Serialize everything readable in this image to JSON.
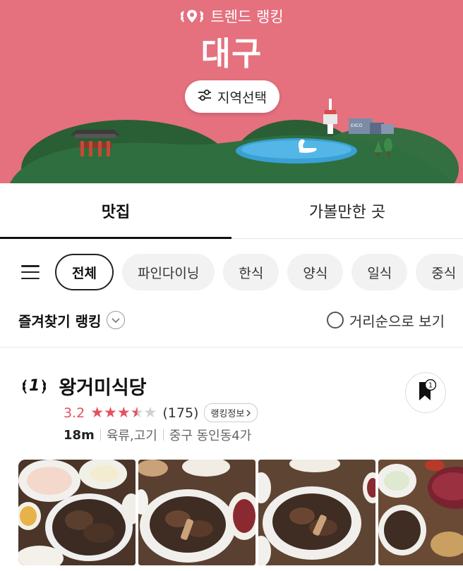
{
  "hero": {
    "subtitle": "트렌드 랭킹",
    "title": "대구",
    "region_button_label": "지역선택",
    "bg_color": "#e5707e",
    "building_sign": "EXCO"
  },
  "tabs": [
    {
      "label": "맛집",
      "active": true
    },
    {
      "label": "가볼만한 곳",
      "active": false
    }
  ],
  "categories": [
    {
      "label": "전체",
      "selected": true
    },
    {
      "label": "파인다이닝",
      "selected": false
    },
    {
      "label": "한식",
      "selected": false
    },
    {
      "label": "양식",
      "selected": false
    },
    {
      "label": "일식",
      "selected": false
    },
    {
      "label": "중식",
      "selected": false
    }
  ],
  "sort": {
    "ranking_label": "즐겨찾기 랭킹",
    "distance_toggle_label": "거리순으로 보기"
  },
  "restaurant": {
    "rank": "1",
    "name": "왕거미식당",
    "score": "3.2",
    "stars_filled": 3.2,
    "reviews": "(175)",
    "info_label": "랭킹정보",
    "distance": "18m",
    "category": "육류,고기",
    "location": "중구 동인동4가",
    "bookmark_count": "1"
  },
  "icons": {
    "subtitle": "laurel-pin-icon",
    "region": "sliders-icon",
    "menu": "hamburger-menu-icon",
    "sort": "chevron-down-icon",
    "bookmark": "bookmark-icon"
  },
  "colors": {
    "accent": "#e5505f",
    "hill": "#2e6b3c"
  }
}
